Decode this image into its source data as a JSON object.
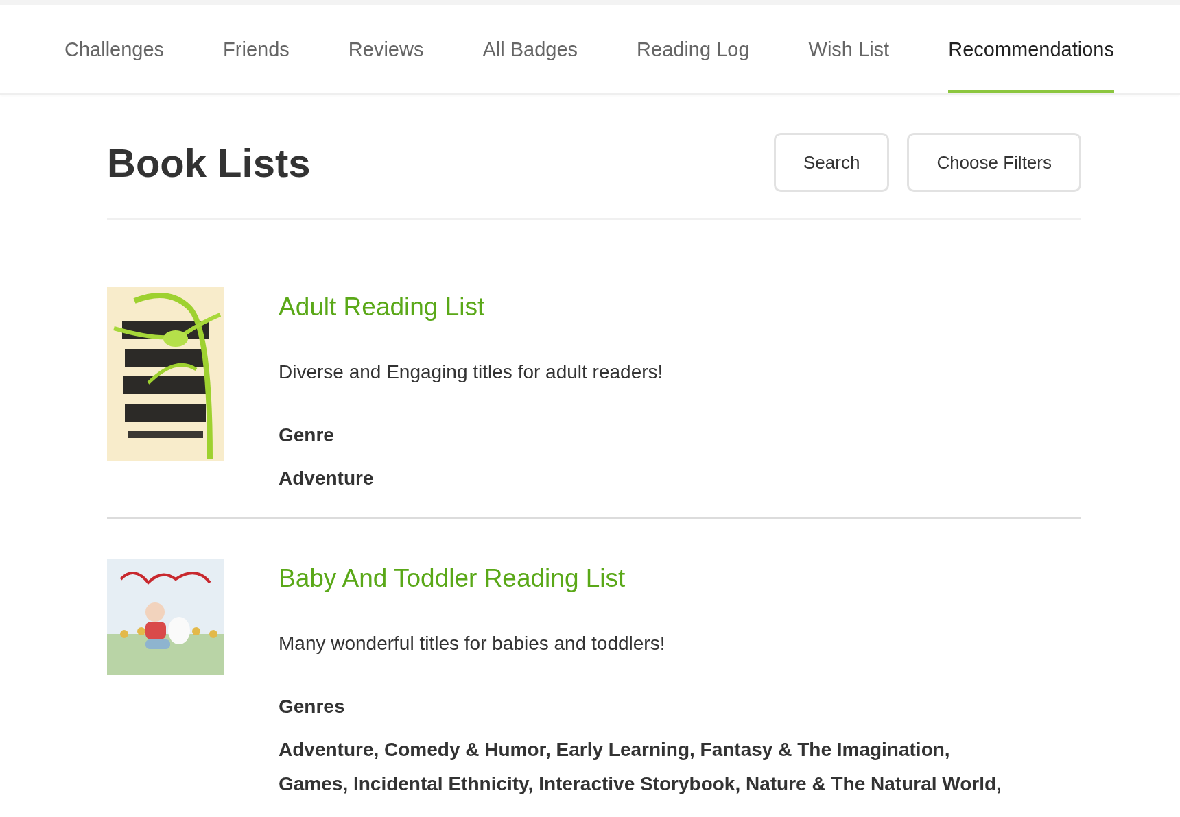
{
  "tabs": [
    {
      "label": "Challenges",
      "selected": false
    },
    {
      "label": "Friends",
      "selected": false
    },
    {
      "label": "Reviews",
      "selected": false
    },
    {
      "label": "All Badges",
      "selected": false
    },
    {
      "label": "Reading Log",
      "selected": false
    },
    {
      "label": "Wish List",
      "selected": false
    },
    {
      "label": "Recommendations",
      "selected": true
    }
  ],
  "page_title": "Book Lists",
  "buttons": [
    "Search",
    "Choose Filters"
  ],
  "lists": [
    {
      "title": "Adult Reading List",
      "description": "Diverse and Engaging titles for adult readers!",
      "genre_label": "Genre",
      "genres": "Adventure"
    },
    {
      "title": "Baby And Toddler Reading List",
      "description": "Many wonderful titles for babies and toddlers!",
      "genre_label": "Genres",
      "genres": "Adventure, Comedy & Humor, Early Learning, Fantasy & The Imagination, Games, Incidental Ethnicity, Interactive Storybook, Nature & The Natural World,"
    }
  ]
}
